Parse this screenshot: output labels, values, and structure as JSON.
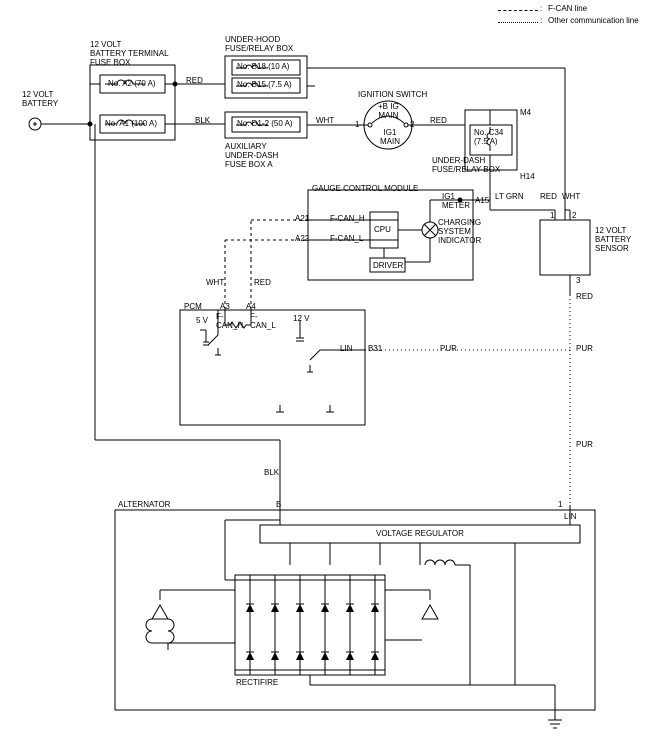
{
  "legend": {
    "fcan": "F-CAN line",
    "other": "Other communication line"
  },
  "battery": "12 VOLT\nBATTERY",
  "battery_terminal_box": "12 VOLT\nBATTERY TERMINAL\nFUSE BOX",
  "fuses": {
    "a2": "No. A2 (70 A)",
    "a1": "No. A1 (100 A)",
    "b18": "No. B18 (10 A)",
    "b15": "No. B15 (7.5 A)",
    "d12": "No. D1-2 (50 A)",
    "c34": "No. C34\n(7.5 A)"
  },
  "underhood_box": "UNDER-HOOD\nFUSE/RELAY BOX",
  "aux_underdash": "AUXILIARY\nUNDER-DASH\nFUSE BOX A",
  "ignition_switch": "IGNITION SWITCH",
  "ignition_labels": {
    "plus_b": "+B IG\nMAIN",
    "ig1": "IG1\nMAIN"
  },
  "underdash_box": "UNDER-DASH\nFUSE/RELAY BOX",
  "gauge_module": "GAUGE CONTROL MODULE",
  "gauge": {
    "cpu": "CPU",
    "driver": "DRIVER",
    "charging": "CHARGING\nSYSTEM\nINDICATOR",
    "ig1_meter": "IG1\nMETER",
    "fcan_h": "F-CAN_H",
    "fcan_l": "F-CAN_L"
  },
  "battery_sensor": "12 VOLT\nBATTERY\nSENSOR",
  "pcm": {
    "title": "PCM",
    "v5": "5 V",
    "v12": "12 V",
    "lin": "LIN",
    "fcan_h": "F-\nCAN_H",
    "fcan_l": "F-\nCAN_L"
  },
  "alternator": {
    "title": "ALTERNATOR",
    "regulator": "VOLTAGE REGULATOR",
    "rectifier": "RECTIFIRE",
    "b": "B",
    "lin": "LIN"
  },
  "wires": {
    "red1": "RED",
    "red2": "RED",
    "red3": "RED",
    "red4": "RED",
    "blk1": "BLK",
    "blk2": "BLK",
    "wht1": "WHT",
    "wht2": "WHT",
    "wht3": "WHT",
    "ltgrn": "LT GRN",
    "pur1": "PUR",
    "pur2": "PUR",
    "pur3": "PUR"
  },
  "pins": {
    "a21": "A21",
    "a22": "A22",
    "a15": "A15",
    "a3": "A3",
    "a4": "A4",
    "b31": "B31",
    "m4": "M4",
    "h14": "H14",
    "p1": "1",
    "p2": "2",
    "p3": "3"
  }
}
